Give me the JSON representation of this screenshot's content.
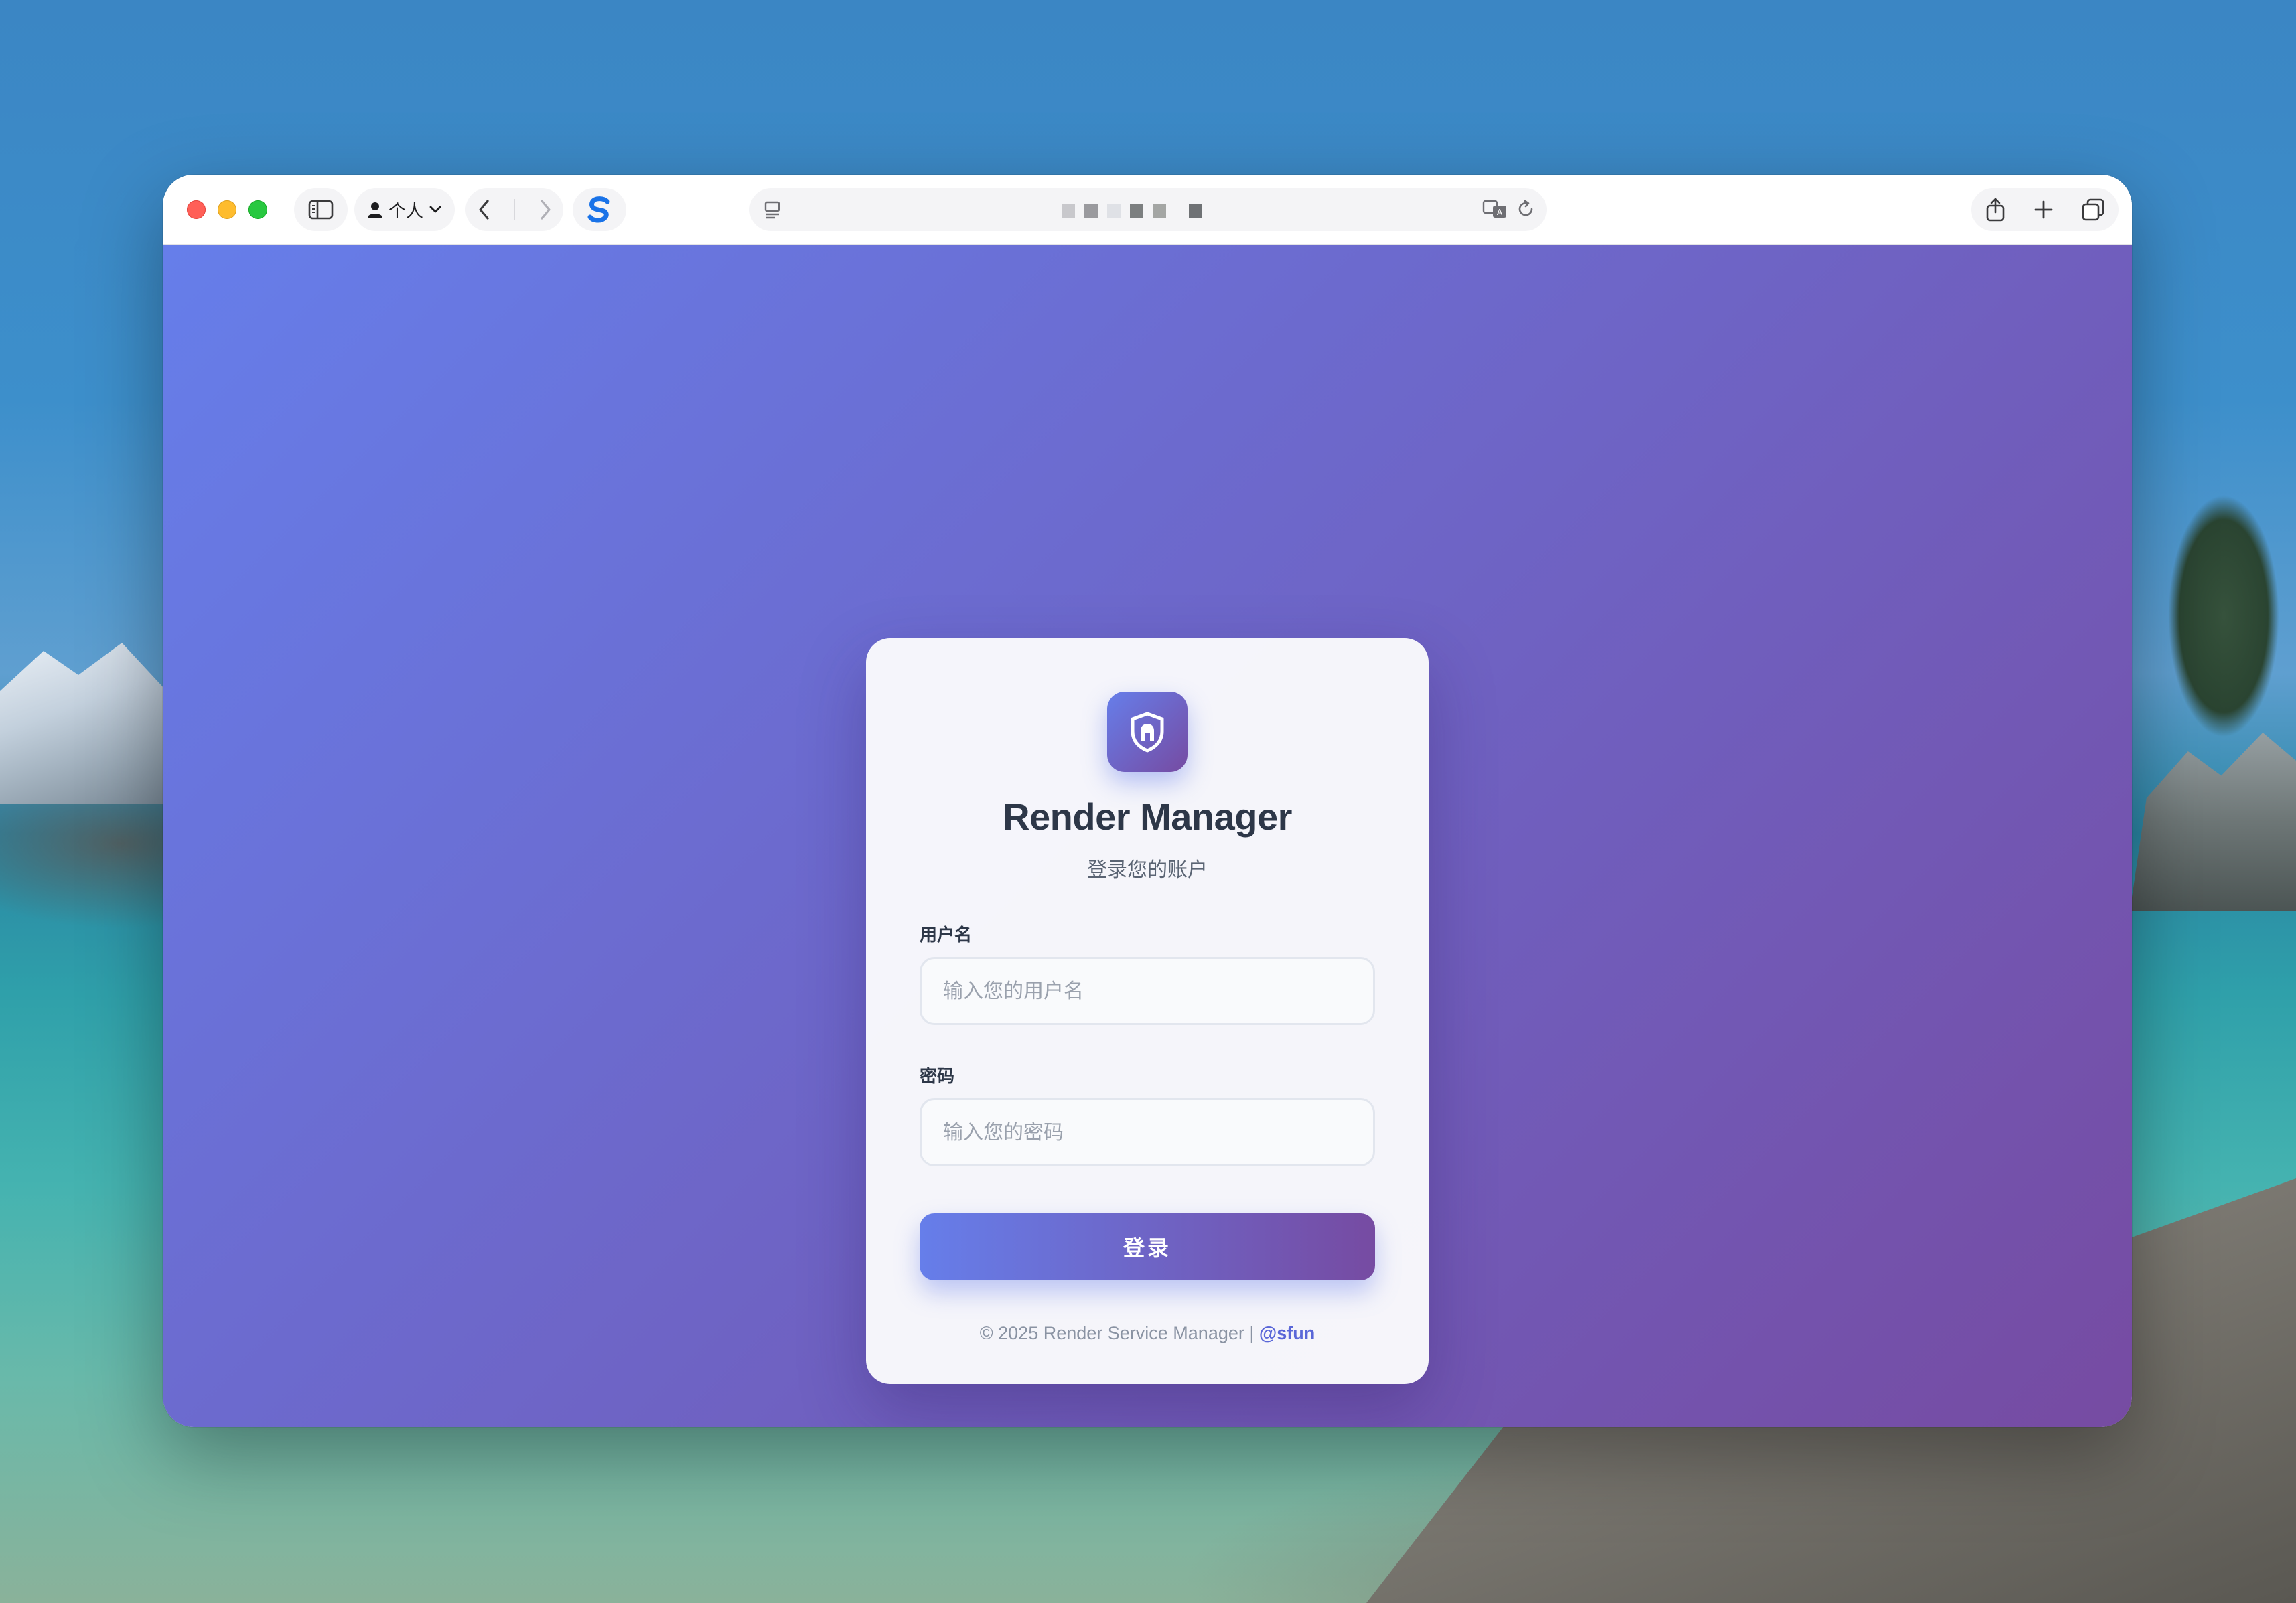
{
  "browser": {
    "profile_label": "个人",
    "address_masked": true
  },
  "login": {
    "app_title": "Render Manager",
    "subtitle": "登录您的账户",
    "username": {
      "label": "用户名",
      "placeholder": "输入您的用户名",
      "value": ""
    },
    "password": {
      "label": "密码",
      "placeholder": "输入您的密码",
      "value": ""
    },
    "submit_label": "登录",
    "footer": {
      "copyright": "© 2025 Render Service Manager |",
      "author_link": "@sfun"
    }
  },
  "icons": {
    "logo": "shield-icon",
    "sidebar": "sidebar-toggle-icon",
    "profile": "person-icon",
    "back": "chevron-left-icon",
    "forward": "chevron-right-icon",
    "extension": "sfun-extension-icon",
    "page_info": "page-menu-icon",
    "translate": "translate-icon",
    "reload": "reload-icon",
    "share": "share-icon",
    "new_tab": "plus-icon",
    "tabs": "tab-overview-icon"
  },
  "colors": {
    "gradient_start": "#667eea",
    "gradient_end": "#764ba2",
    "title": "#2d3748",
    "link": "#5a67d8"
  }
}
